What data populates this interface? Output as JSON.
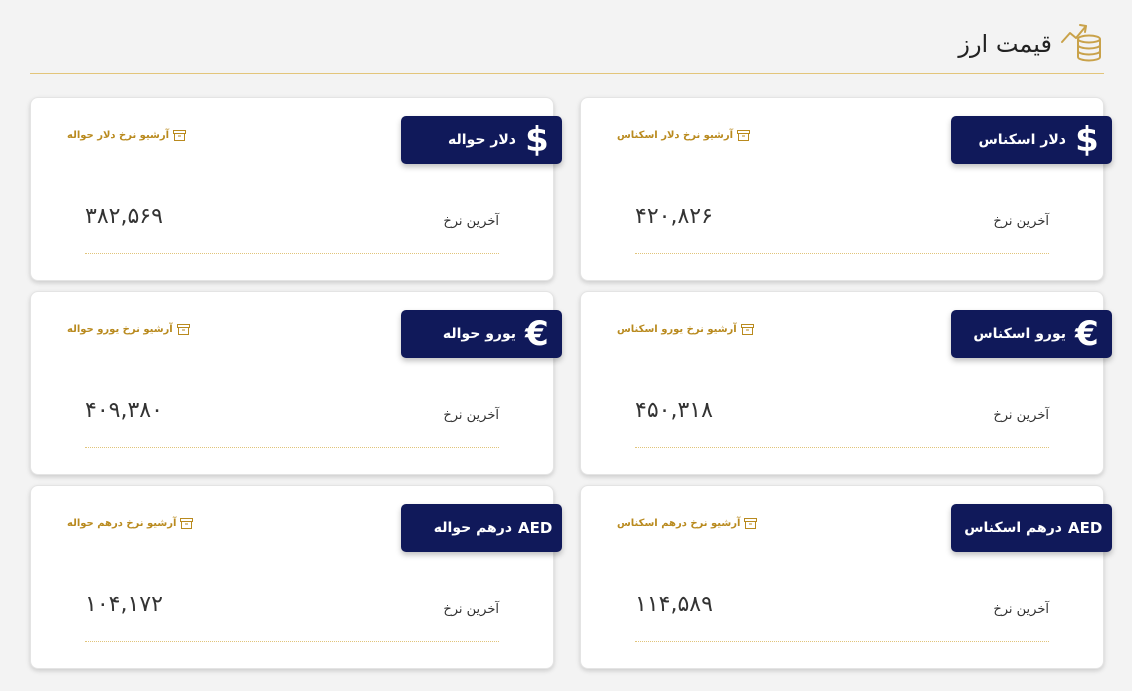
{
  "header": {
    "title": "قیمت ارز",
    "icon": "coins-chart-icon",
    "accent_color": "#c9a24a"
  },
  "theme": {
    "badge_color": "#10195a",
    "archive_color": "#b98a1e",
    "page_background": "#f3f3f3"
  },
  "cards": [
    {
      "title": "دلار اسکناس",
      "symbol": "$",
      "archive_label": "آرشیو نرخ دلار اسکناس",
      "rate_label": "آخرین نرخ",
      "rate": "۴۲۰,۸۲۶"
    },
    {
      "title": "دلار حواله",
      "symbol": "$",
      "archive_label": "آرشیو نرخ دلار حواله",
      "rate_label": "آخرین نرخ",
      "rate": "۳۸۲,۵۶۹"
    },
    {
      "title": "یورو اسکناس",
      "symbol": "€",
      "archive_label": "آرشیو نرخ یورو اسکناس",
      "rate_label": "آخرین نرخ",
      "rate": "۴۵۰,۳۱۸"
    },
    {
      "title": "یورو حواله",
      "symbol": "€",
      "archive_label": "آرشیو نرخ یورو حواله",
      "rate_label": "آخرین نرخ",
      "rate": "۴۰۹,۳۸۰"
    },
    {
      "title": "درهم اسکناس",
      "symbol": "AED",
      "archive_label": "آرشیو نرخ درهم اسکناس",
      "rate_label": "آخرین نرخ",
      "rate": "۱۱۴,۵۸۹"
    },
    {
      "title": "درهم حواله",
      "symbol": "AED",
      "archive_label": "آرشیو نرخ درهم حواله",
      "rate_label": "آخرین نرخ",
      "rate": "۱۰۴,۱۷۲"
    }
  ]
}
